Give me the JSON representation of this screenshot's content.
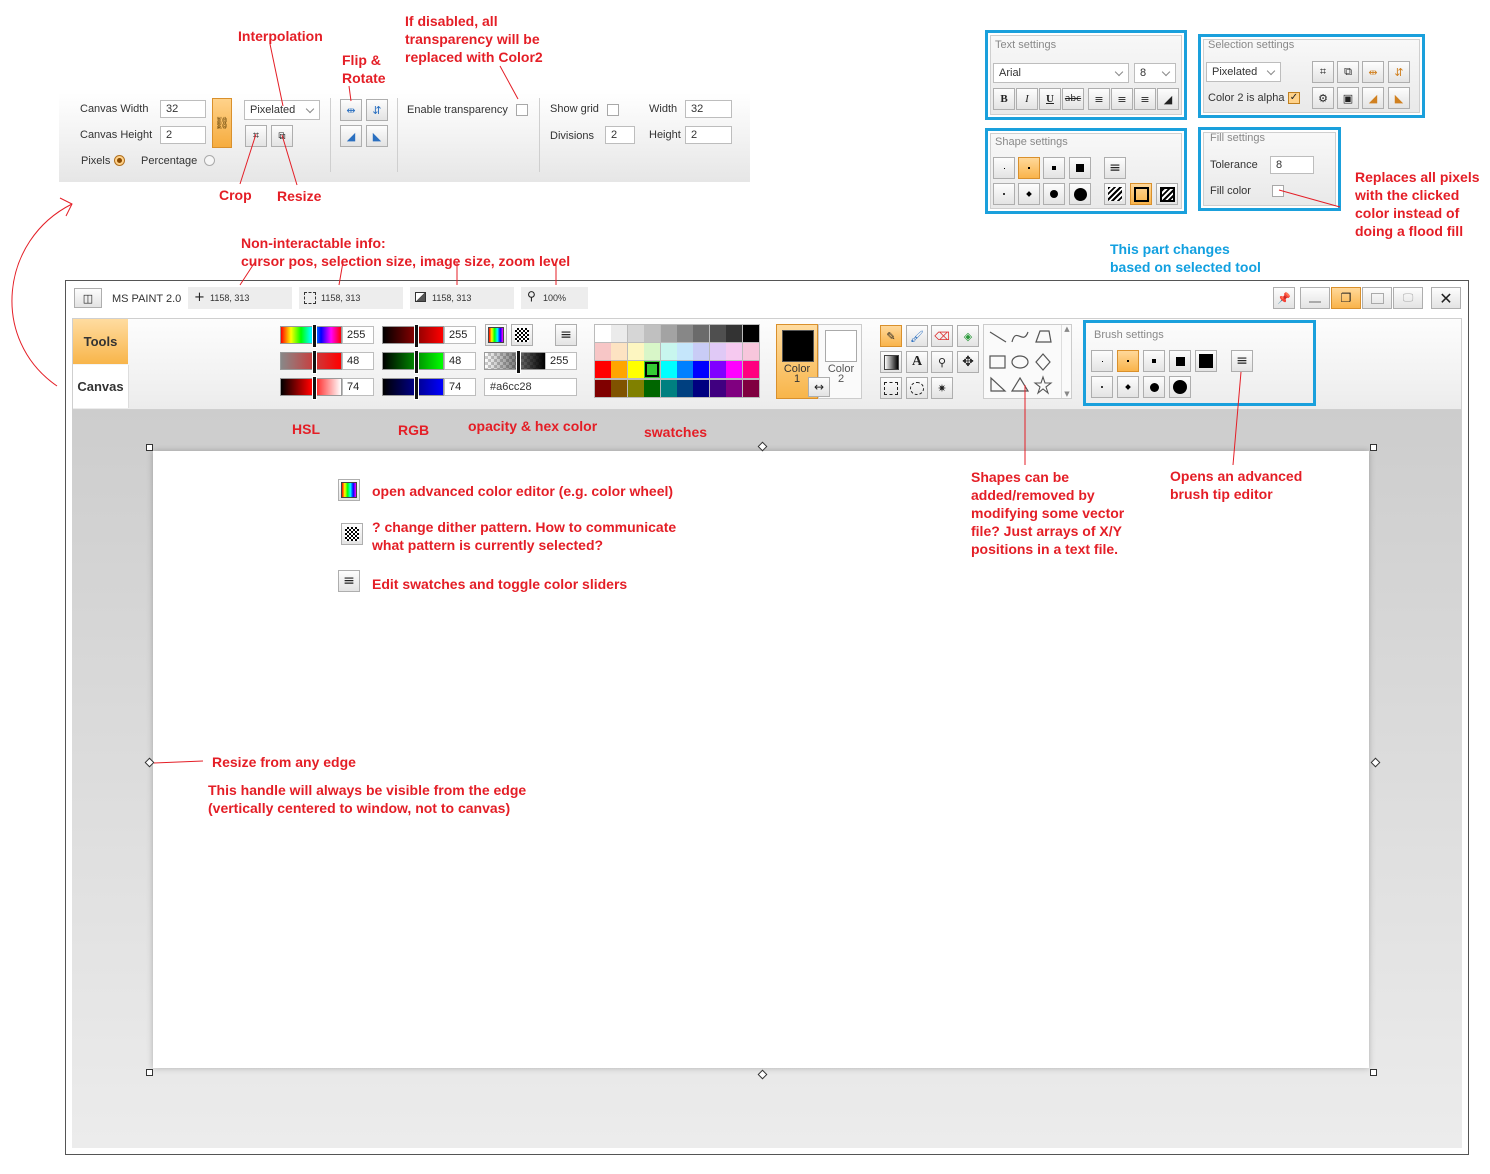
{
  "annotations": {
    "interpolation": "Interpolation",
    "flip_rotate": "Flip &\nRotate",
    "transparency_note": "If disabled, all\ntransparency will be\nreplaced with Color2",
    "crop": "Crop",
    "resize": "Resize",
    "status_info": "Non-interactable info:\ncursor pos, selection size, image size, zoom level",
    "part_changes": "This part changes\nbased on selected tool",
    "replaces_pixels": "Replaces all pixels\nwith the clicked\ncolor instead of\ndoing a flood fill",
    "hsl": "HSL",
    "rgb": "RGB",
    "opacity_hex": "opacity & hex color",
    "swatches": "swatches",
    "shapes_note": "Shapes can be\nadded/removed by\nmodifying some vector\nfile? Just arrays of X/Y\npositions in a text file.",
    "brush_editor_note": "Opens an advanced\nbrush tip editor",
    "color_editor_note": "open advanced color editor (e.g. color wheel)",
    "dither_note": "? change dither pattern. How to communicate\nwhat pattern is currently selected?",
    "swatch_edit_note": "Edit swatches and toggle color sliders",
    "resize_edge": "Resize from any edge",
    "handle_note": "This handle will always be visible from the edge\n(vertically centered to window, not to canvas)"
  },
  "canvas_panel": {
    "width_label": "Canvas Width",
    "width_value": "32",
    "height_label": "Canvas Height",
    "height_value": "2",
    "pixels_label": "Pixels",
    "percentage_label": "Percentage",
    "interpolation_value": "Pixelated",
    "enable_transparency": "Enable transparency",
    "show_grid": "Show grid",
    "divisions_label": "Divisions",
    "divisions_value": "2",
    "grid_width_label": "Width",
    "grid_width_value": "32",
    "grid_height_label": "Height",
    "grid_height_value": "2"
  },
  "text_settings": {
    "title": "Text settings",
    "font": "Arial",
    "size": "8"
  },
  "selection_settings": {
    "title": "Selection settings",
    "interpolation": "Pixelated",
    "color2_alpha": "Color 2 is alpha"
  },
  "shape_settings": {
    "title": "Shape settings"
  },
  "fill_settings": {
    "title": "Fill settings",
    "tolerance_label": "Tolerance",
    "tolerance_value": "8",
    "fill_color_label": "Fill color"
  },
  "titlebar": {
    "app_name": "MS PAINT 2.0",
    "cursor_pos": "1158, 313",
    "selection_size": "1158, 313",
    "image_size": "1158, 313",
    "zoom": "100%"
  },
  "tabs": {
    "tools": "Tools",
    "canvas": "Canvas"
  },
  "color_sliders": {
    "h": "255",
    "s": "48",
    "l": "74",
    "r": "255",
    "g": "48",
    "b": "74",
    "opacity": "255",
    "hex": "#a6cc28"
  },
  "color_slots": {
    "color1": "Color\n1",
    "color2": "Color\n2"
  },
  "brush_settings": {
    "title": "Brush settings"
  },
  "colors": {
    "accent": "#f9b44b",
    "annotation_red": "#e41e26",
    "annotation_blue": "#12a0e0"
  },
  "swatch_colors": [
    [
      "#ffffff",
      "#ebebeb",
      "#d6d6d6",
      "#c0c0c0",
      "#a3a3a3",
      "#878787",
      "#6b6b6b",
      "#4f4f4f",
      "#333333",
      "#000000"
    ],
    [
      "#f7c6c6",
      "#fde3c2",
      "#fdf6c1",
      "#d8f6c8",
      "#c8f6ee",
      "#c5e6fb",
      "#c9ccf6",
      "#e0c9f6",
      "#f6c9f0",
      "#f7c6dc"
    ],
    [
      "#ff0000",
      "#ffa500",
      "#ffff00",
      "#33cc33",
      "#00ffff",
      "#0080ff",
      "#0000ff",
      "#8000ff",
      "#ff00ff",
      "#ff0080"
    ],
    [
      "#800000",
      "#805300",
      "#808000",
      "#006600",
      "#008080",
      "#004080",
      "#000080",
      "#400080",
      "#800080",
      "#800040"
    ]
  ]
}
